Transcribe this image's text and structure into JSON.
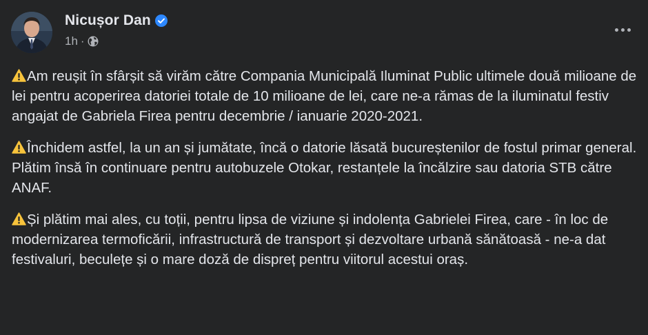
{
  "author": {
    "name": "Nicușor Dan",
    "time": "1h",
    "separator": "·",
    "verified_icon": "verified-badge-icon",
    "audience_icon": "globe-icon",
    "verified_color": "#2d88ff"
  },
  "post": {
    "paragraphs": [
      "Am reușit în sfârșit să virăm către Compania Municipală Iluminat Public ultimele două milioane de lei pentru acoperirea datoriei totale de 10 milioane de lei, care ne-a rămas de la iluminatul festiv angajat de Gabriela Firea pentru decembrie / ianuarie 2020-2021.",
      "Închidem astfel, la un an și jumătate, încă o datorie lăsată bucureștenilor de fostul primar general. Plătim însă în continuare pentru autobuzele Otokar, restanțele la încălzire sau datoria STB către ANAF.",
      "Și plătim mai ales, cu toții, pentru lipsa de viziune și indolența Gabrielei Firea, care - în loc de modernizarea termoficării, infrastructură de transport și dezvoltare urbană sănătoasă - ne-a dat festivaluri, beculețe și o mare doză de dispreț pentru viitorul acestui oraș."
    ],
    "paragraph_icon": "warning-icon"
  },
  "menu": {
    "icon": "more-options-icon"
  },
  "colors": {
    "background": "#242526",
    "text": "#e4e6eb",
    "secondary_text": "#b0b3b8",
    "warning": "#f7c33c"
  }
}
